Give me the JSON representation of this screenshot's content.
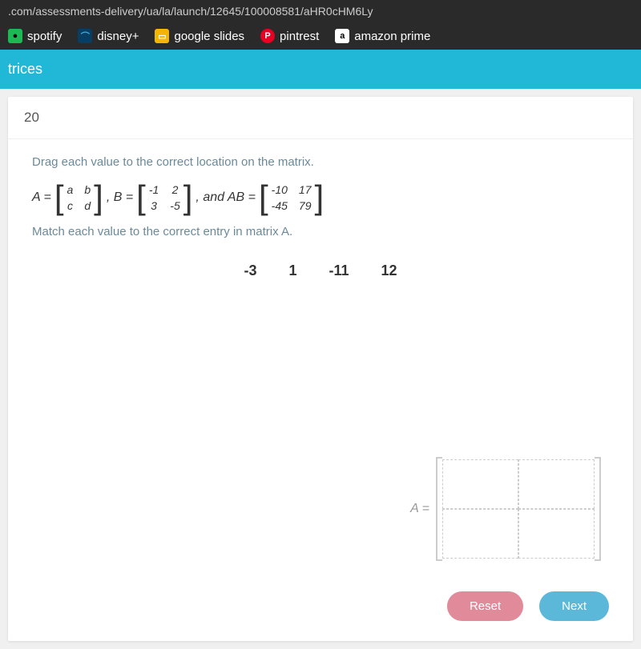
{
  "address_bar": ".com/assessments-delivery/ua/la/launch/12645/100008581/aHR0cHM6Ly",
  "bookmarks": {
    "spotify": "spotify",
    "disney": "disney+",
    "slides": "google slides",
    "pinterest": "pintrest",
    "amazon": "amazon prime"
  },
  "page_title_fragment": "trices",
  "question": {
    "number": "20",
    "instruction": "Drag each value to the correct location on the matrix.",
    "sub_instruction": "Match each value to the correct entry in matrix A.",
    "matrix_A": {
      "label": "A =",
      "cells": [
        "a",
        "b",
        "c",
        "d"
      ]
    },
    "matrix_B": {
      "label": ", B =",
      "cells": [
        "-1",
        "2",
        "3",
        "-5"
      ]
    },
    "and_text": ", and AB =",
    "matrix_AB": {
      "cells": [
        "-10",
        "17",
        "-45",
        "79"
      ]
    },
    "draggable_values": [
      "-3",
      "1",
      "-11",
      "12"
    ],
    "drop_label": "A ="
  },
  "buttons": {
    "reset": "Reset",
    "next": "Next"
  }
}
